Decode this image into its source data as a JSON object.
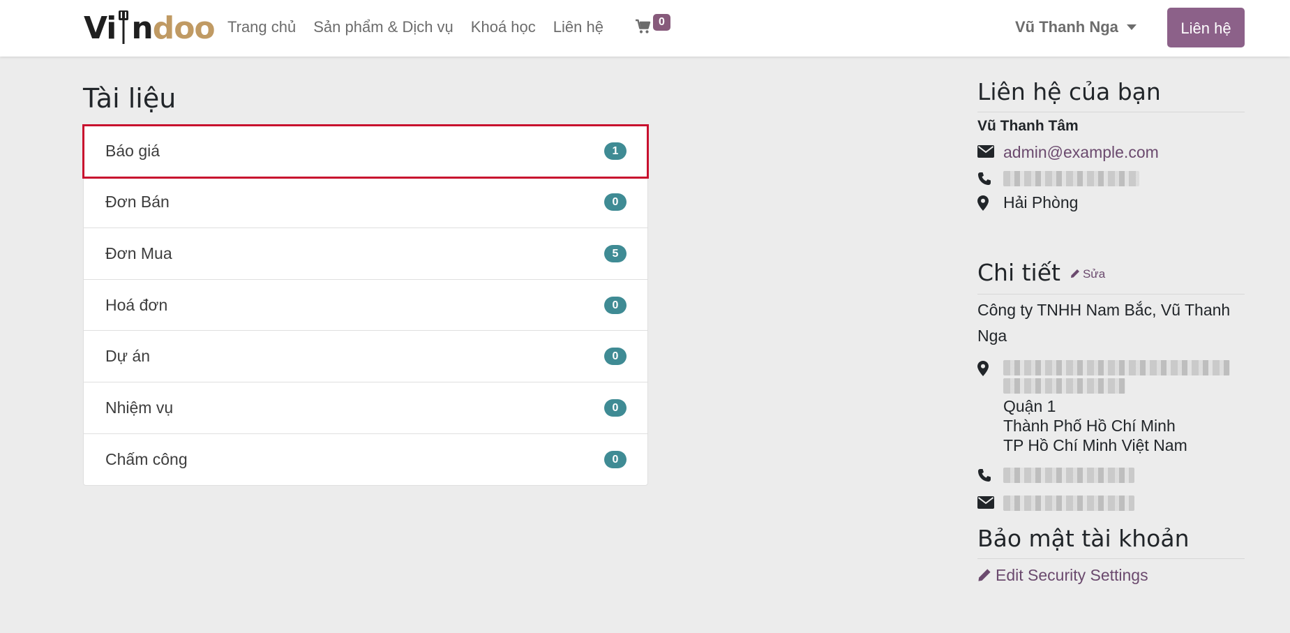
{
  "header": {
    "logo_text": [
      "Vi",
      "n",
      "doo"
    ],
    "nav": [
      "Trang chủ",
      "Sản phẩm & Dịch vụ",
      "Khoá học",
      "Liên hệ"
    ],
    "cart_count": "0",
    "user_name": "Vũ Thanh Nga",
    "contact_button": "Liên hệ",
    "colors": {
      "accent": "#875a7b",
      "logo_tan": "#c09a63"
    }
  },
  "documents": {
    "title": "Tài liệu",
    "items": [
      {
        "label": "Báo giá",
        "count": "1"
      },
      {
        "label": "Đơn Bán",
        "count": "0"
      },
      {
        "label": "Đơn Mua",
        "count": "5"
      },
      {
        "label": "Hoá đơn",
        "count": "0"
      },
      {
        "label": "Dự án",
        "count": "0"
      },
      {
        "label": "Nhiệm vụ",
        "count": "0"
      },
      {
        "label": "Chấm công",
        "count": "0"
      }
    ],
    "badge_color": "#3f8b94",
    "selected_index": 0
  },
  "contact": {
    "title": "Liên hệ của bạn",
    "name": "Vũ Thanh Tâm",
    "email": "admin@example.com",
    "city": "Hải Phòng"
  },
  "details": {
    "title": "Chi tiết",
    "edit_label": "Sửa",
    "company": "Công ty TNHH Nam Bắc, Vũ Thanh Nga",
    "address": [
      "Quận 1",
      "Thành Phố Hồ Chí Minh",
      "TP Hồ Chí Minh Việt Nam"
    ]
  },
  "security": {
    "title": "Bảo mật tài khoản",
    "edit_link": "Edit Security Settings"
  },
  "icons": [
    "cart-icon",
    "envelope-icon",
    "phone-icon",
    "map-marker-icon",
    "pencil-icon",
    "caret-down-icon"
  ]
}
